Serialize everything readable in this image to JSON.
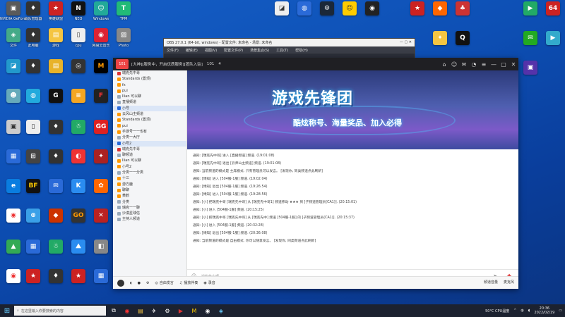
{
  "desktop_icons_left": [
    {
      "label": "NVIDIA GeForce",
      "color": "#555"
    },
    {
      "label": "战队管理器",
      "color": "#333"
    },
    {
      "label": "英雄联盟",
      "color": "#c22"
    },
    {
      "label": "NEO",
      "color": "#111"
    },
    {
      "label": "Windows",
      "color": "#3a7"
    },
    {
      "label": "TPM",
      "color": "#2b7"
    },
    {
      "label": "文件",
      "color": "#f5c542"
    },
    {
      "label": "此电脑",
      "color": "#4a8"
    },
    {
      "label": "游戏",
      "color": "#c33"
    },
    {
      "label": "cpu",
      "color": "#777"
    },
    {
      "label": "网易云音乐",
      "color": "#d23"
    },
    {
      "label": "Photo",
      "color": "#888"
    }
  ],
  "obs": {
    "title": "OBS 27.0.1 (64-bit, windows) - 配置文件: 未命名 - 场景: 未命名",
    "menu": [
      "文件(F)",
      "编辑(E)",
      "视图(V)",
      "配置文件(P)",
      "场景集合(S)",
      "工具(T)",
      "帮助(H)"
    ]
  },
  "app": {
    "topbar_text": "[大神][服务中，开启优质服务][团队入驻]",
    "topbar_id": "101",
    "topbar_count": "4",
    "banner_title": "游戏先锋团",
    "banner_sub": "酷炫称号、海量奖品、加入必得",
    "sidebar": [
      "瑞克先中哥",
      "Standards (置顶)",
      "fx",
      "pui",
      "Ilian 可以聊",
      "直播频道",
      "小号",
      "云风山主频道",
      "Standards (置顶)",
      "pui",
      "手游号一一也有",
      "分类一大厅",
      "小号2",
      "瑞克先中哥",
      "聊频道",
      "Ilian 可以聊",
      "小号2",
      "分类一一分类",
      "十三",
      "游方鹿",
      "聊聊",
      "黄鹤",
      "分类",
      "瑞克一一聊",
      "沙漠星球信",
      "主持人频道"
    ],
    "messages": [
      "通知: [瑞克先中哥] 进入 [直播频道] 频道. (19:01:08)",
      "通知: [瑞克先中哥] 退出 [云师山主频道] 频道. (19:01:08)",
      "通知: 当前频道的模式是 主席模式. 只有管理员可以发言。 [发现你, 同类频道点此刷新]",
      "通知: [博知] 进入 [504服-1服] 频道. (19:02:04)",
      "通知: [博知] 退出 [504服-1服] 频道. (19:26:54)",
      "通知: [博知] 进入 [504服-1服] 频道. (19:28:56)",
      "通知: [小] 把瑞克中哥 [瑞克先中哥] 从 [瑞克先中哥1] 频道移动 ★★★ 到 [子频道管理员(CA1)]. (20:15:01)",
      "通知: [小] 进入 [504服-1服] 频道. (20:15:25)",
      "通知: [小] 把瑞克中哥 [瑞克先中哥] 从 [瑞克先中] 频道 [504服-1服] 的 [子频道管理员(CA1)]. (20:15:37)",
      "通知: [小] 进入 [504服-1服] 频道. (20:32:28)",
      "通知: [博知] 退出 [504服-1服] 频道. (20:36:08)",
      "通知: 当前频道的模式是 自由模式. 你可以随意发言。 [发现你, 同类频道点此刷新]"
    ],
    "input_placeholder": "说些什么呢...",
    "tools": [
      "自由发言",
      "播放伴奏",
      "录音"
    ],
    "status_left": "频道音量",
    "status_right": "麦克风"
  },
  "taskbar": {
    "search_placeholder": "在这里输入你要搜索的内容",
    "weather": "50°C CPU温度",
    "time": "20:36",
    "date": "2022/02/19"
  }
}
